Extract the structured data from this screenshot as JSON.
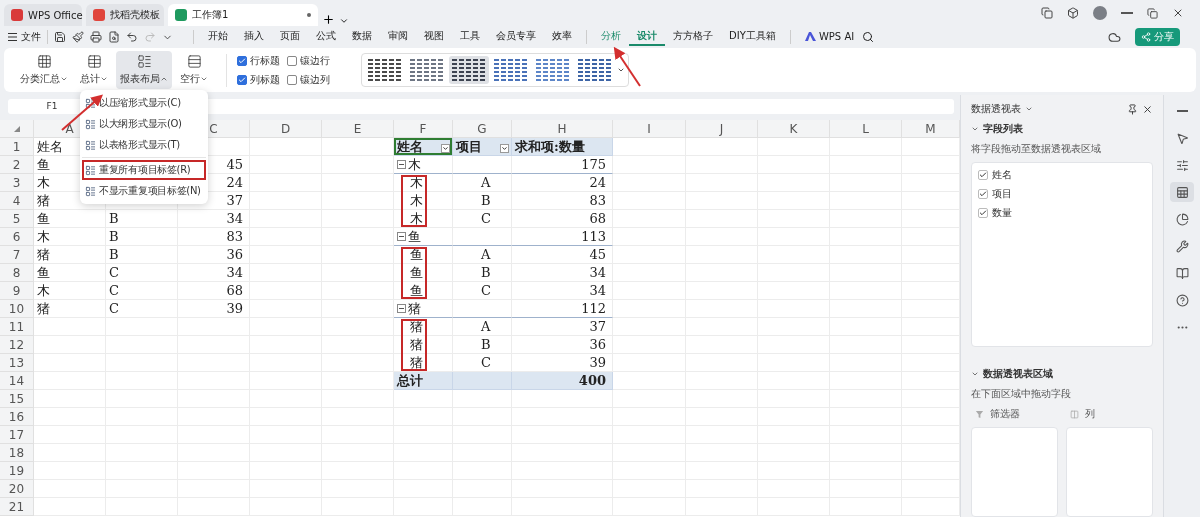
{
  "title_tabs": [
    {
      "label": "WPS Office",
      "kind": "home",
      "selected": false
    },
    {
      "label": "找稻壳模板",
      "kind": "template",
      "selected": false
    },
    {
      "label": "工作簿1",
      "kind": "sheet",
      "selected": true
    }
  ],
  "menu": {
    "file": "文件",
    "tabs": [
      {
        "label": "开始",
        "selected": false,
        "kind": "normal"
      },
      {
        "label": "插入",
        "selected": false,
        "kind": "normal"
      },
      {
        "label": "页面",
        "selected": false,
        "kind": "normal"
      },
      {
        "label": "公式",
        "selected": false,
        "kind": "normal"
      },
      {
        "label": "数据",
        "selected": false,
        "kind": "normal"
      },
      {
        "label": "审阅",
        "selected": false,
        "kind": "normal"
      },
      {
        "label": "视图",
        "selected": false,
        "kind": "normal"
      },
      {
        "label": "工具",
        "selected": false,
        "kind": "normal"
      },
      {
        "label": "会员专享",
        "selected": false,
        "kind": "normal"
      },
      {
        "label": "效率",
        "selected": false,
        "kind": "normal"
      },
      {
        "label": "分析",
        "selected": false,
        "kind": "context"
      },
      {
        "label": "设计",
        "selected": true,
        "kind": "context"
      },
      {
        "label": "方方格子",
        "selected": false,
        "kind": "normal"
      },
      {
        "label": "DIY工具箱",
        "selected": false,
        "kind": "normal"
      }
    ],
    "ai": "WPS AI",
    "share": "分享"
  },
  "ribbon": {
    "buttons": [
      {
        "label": "分类汇总",
        "kind": "grid",
        "pressed": false,
        "expanded": false
      },
      {
        "label": "总计",
        "kind": "table",
        "pressed": false,
        "expanded": false
      },
      {
        "label": "报表布局",
        "kind": "layout",
        "pressed": true,
        "expanded": true
      },
      {
        "label": "空行",
        "kind": "rows",
        "pressed": false,
        "expanded": false
      }
    ],
    "options": [
      {
        "label": "行标题",
        "checked": true
      },
      {
        "label": "镶边行",
        "checked": false
      },
      {
        "label": "列标题",
        "checked": true
      },
      {
        "label": "镶边列",
        "checked": false
      }
    ],
    "styles": [
      {
        "color": "#4a4a4a",
        "selected": false
      },
      {
        "color": "#6e7684",
        "selected": false
      },
      {
        "color": "#3c4250",
        "selected": true
      },
      {
        "color": "#4a72b8",
        "selected": false
      },
      {
        "color": "#5d86c8",
        "selected": false
      },
      {
        "color": "#3e65a6",
        "selected": false
      }
    ]
  },
  "layout_menu": [
    {
      "label": "以压缩形式显示(C)",
      "highlighted": false
    },
    {
      "label": "以大纲形式显示(O)",
      "highlighted": false
    },
    {
      "label": "以表格形式显示(T)",
      "highlighted": false
    },
    {
      "label": "重复所有项目标签(R)",
      "highlighted": true
    },
    {
      "label": "不显示重复项目标签(N)",
      "highlighted": false
    }
  ],
  "name_box": "F1",
  "columns": [
    "A",
    null,
    "C",
    "D",
    "E",
    "F",
    "G",
    "H",
    "I",
    "J",
    "K",
    "L",
    "M"
  ],
  "row_numbers": [
    "1",
    "2",
    "3",
    "4",
    "5",
    "6",
    "7",
    "8",
    "9",
    "10",
    "11",
    "12",
    "13",
    "14",
    "15",
    "16",
    "17",
    "18",
    "19",
    "20",
    "21"
  ],
  "source_rows": [
    [
      "姓名",
      null,
      null
    ],
    [
      "鱼",
      null,
      "45"
    ],
    [
      "木",
      null,
      "24"
    ],
    [
      "猪",
      null,
      "37"
    ],
    [
      "鱼",
      "B",
      "34"
    ],
    [
      "木",
      "B",
      "83"
    ],
    [
      "猪",
      "B",
      "36"
    ],
    [
      "鱼",
      "C",
      "34"
    ],
    [
      "木",
      "C",
      "68"
    ],
    [
      "猪",
      "C",
      "39"
    ]
  ],
  "pivot": {
    "headers": [
      {
        "label": "姓名",
        "filter": true,
        "selected": true
      },
      {
        "label": "项目",
        "filter": true,
        "selected": false
      },
      {
        "label": "求和项:数量",
        "filter": false,
        "selected": false
      }
    ],
    "groups": [
      {
        "name": "木",
        "total": "175",
        "expanded": true,
        "highlighted": true,
        "rows": [
          {
            "name": "木",
            "item": "A",
            "value": "24"
          },
          {
            "name": "木",
            "item": "B",
            "value": "83"
          },
          {
            "name": "木",
            "item": "C",
            "value": "68"
          }
        ]
      },
      {
        "name": "鱼",
        "total": "113",
        "expanded": true,
        "highlighted": true,
        "rows": [
          {
            "name": "鱼",
            "item": "A",
            "value": "45"
          },
          {
            "name": "鱼",
            "item": "B",
            "value": "34"
          },
          {
            "name": "鱼",
            "item": "C",
            "value": "34"
          }
        ]
      },
      {
        "name": "猪",
        "total": "112",
        "expanded": true,
        "highlighted": true,
        "rows": [
          {
            "name": "猪",
            "item": "A",
            "value": "37"
          },
          {
            "name": "猪",
            "item": "B",
            "value": "36"
          },
          {
            "name": "猪",
            "item": "C",
            "value": "39"
          }
        ]
      }
    ],
    "grand_total": {
      "label": "总计",
      "value": "400"
    }
  },
  "panel": {
    "title": "数据透视表",
    "field_section": "字段列表",
    "field_hint": "将字段拖动至数据透视表区域",
    "fields": [
      {
        "label": "姓名",
        "checked": true
      },
      {
        "label": "项目",
        "checked": true
      },
      {
        "label": "数量",
        "checked": true
      }
    ],
    "area_section": "数据透视表区域",
    "area_hint": "在下面区域中拖动字段",
    "areas": [
      {
        "label": "筛选器",
        "kind": "filter"
      },
      {
        "label": "列",
        "kind": "columns"
      }
    ]
  },
  "side_tools": [
    {
      "kind": "minimize",
      "selected": false
    },
    {
      "kind": "select",
      "selected": false
    },
    {
      "kind": "sliders",
      "selected": false
    },
    {
      "kind": "pivot",
      "selected": true
    },
    {
      "kind": "chart",
      "selected": false
    },
    {
      "kind": "tools",
      "selected": false
    },
    {
      "kind": "book",
      "selected": false
    },
    {
      "kind": "help",
      "selected": false
    },
    {
      "kind": "more",
      "selected": false
    }
  ]
}
